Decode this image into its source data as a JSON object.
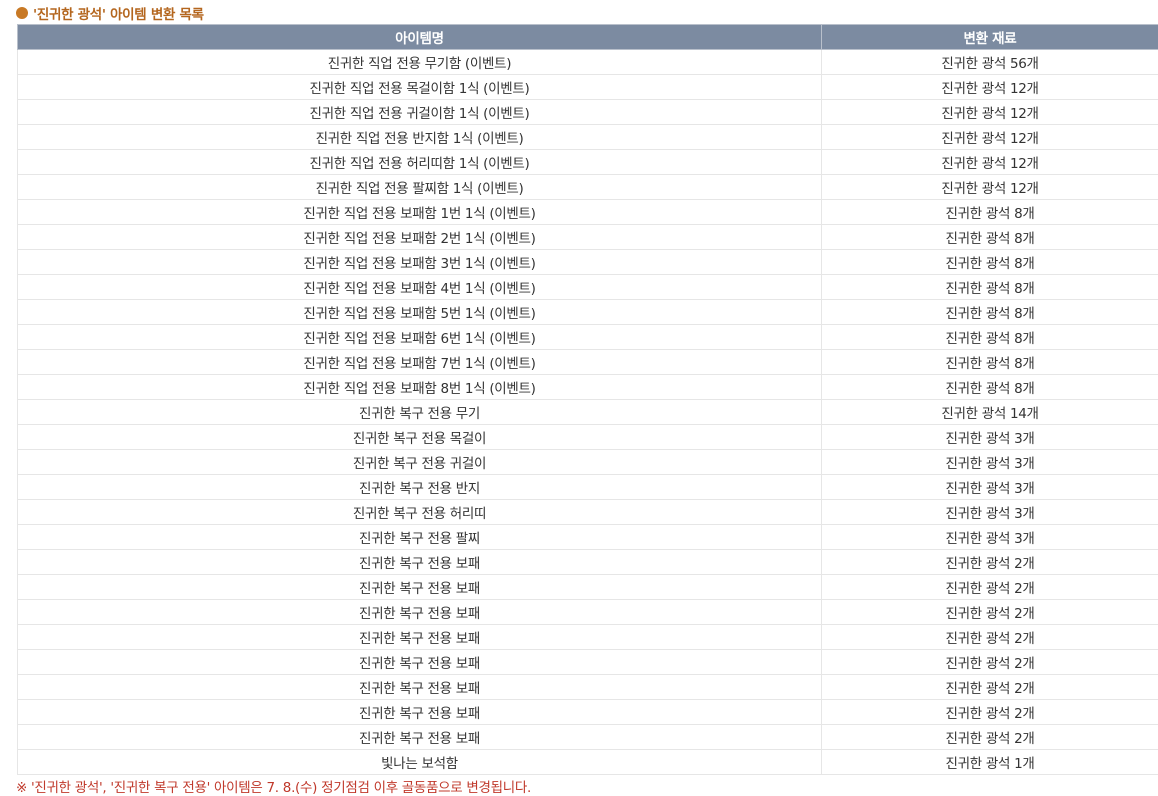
{
  "header": {
    "title": "'진귀한 광석' 아이템 변환 목록",
    "bullet_color": "#c87925",
    "title_color": "#b4661e"
  },
  "table": {
    "columns": [
      "아이템명",
      "변환 재료"
    ],
    "header_bg": "#7c8ba1",
    "rows": [
      {
        "item": "진귀한 직업 전용 무기함 (이벤트)",
        "material": "진귀한 광석 56개"
      },
      {
        "item": "진귀한 직업 전용 목걸이함 1식 (이벤트)",
        "material": "진귀한 광석 12개"
      },
      {
        "item": "진귀한 직업 전용 귀걸이함 1식 (이벤트)",
        "material": "진귀한 광석 12개"
      },
      {
        "item": "진귀한 직업 전용 반지함 1식 (이벤트)",
        "material": "진귀한 광석 12개"
      },
      {
        "item": "진귀한 직업 전용 허리띠함 1식 (이벤트)",
        "material": "진귀한 광석 12개"
      },
      {
        "item": "진귀한 직업 전용 팔찌함 1식 (이벤트)",
        "material": "진귀한 광석 12개"
      },
      {
        "item": "진귀한 직업 전용 보패함 1번 1식 (이벤트)",
        "material": "진귀한 광석 8개"
      },
      {
        "item": "진귀한 직업 전용 보패함 2번 1식 (이벤트)",
        "material": "진귀한 광석 8개"
      },
      {
        "item": "진귀한 직업 전용 보패함 3번 1식 (이벤트)",
        "material": "진귀한 광석 8개"
      },
      {
        "item": "진귀한 직업 전용 보패함 4번 1식 (이벤트)",
        "material": "진귀한 광석 8개"
      },
      {
        "item": "진귀한 직업 전용 보패함 5번 1식 (이벤트)",
        "material": "진귀한 광석 8개"
      },
      {
        "item": "진귀한 직업 전용 보패함 6번 1식 (이벤트)",
        "material": "진귀한 광석 8개"
      },
      {
        "item": "진귀한 직업 전용 보패함 7번 1식 (이벤트)",
        "material": "진귀한 광석 8개"
      },
      {
        "item": "진귀한 직업 전용 보패함 8번 1식 (이벤트)",
        "material": "진귀한 광석 8개"
      },
      {
        "item": "진귀한 복구 전용 무기",
        "material": "진귀한 광석 14개"
      },
      {
        "item": "진귀한 복구 전용 목걸이",
        "material": "진귀한 광석 3개"
      },
      {
        "item": "진귀한 복구 전용 귀걸이",
        "material": "진귀한 광석 3개"
      },
      {
        "item": "진귀한 복구 전용 반지",
        "material": "진귀한 광석 3개"
      },
      {
        "item": "진귀한 복구 전용 허리띠",
        "material": "진귀한 광석 3개"
      },
      {
        "item": "진귀한 복구 전용 팔찌",
        "material": "진귀한 광석 3개"
      },
      {
        "item": "진귀한 복구 전용 보패",
        "material": "진귀한 광석 2개"
      },
      {
        "item": "진귀한 복구 전용 보패",
        "material": "진귀한 광석 2개"
      },
      {
        "item": "진귀한 복구 전용 보패",
        "material": "진귀한 광석 2개"
      },
      {
        "item": "진귀한 복구 전용 보패",
        "material": "진귀한 광석 2개"
      },
      {
        "item": "진귀한 복구 전용 보패",
        "material": "진귀한 광석 2개"
      },
      {
        "item": "진귀한 복구 전용 보패",
        "material": "진귀한 광석 2개"
      },
      {
        "item": "진귀한 복구 전용 보패",
        "material": "진귀한 광석 2개"
      },
      {
        "item": "진귀한 복구 전용 보패",
        "material": "진귀한 광석 2개"
      },
      {
        "item": "빛나는 보석함",
        "material": "진귀한 광석 1개"
      }
    ]
  },
  "footnote": {
    "text": "※ '진귀한 광석', '진귀한 복구 전용' 아이템은 7. 8.(수) 정기점검 이후 골동품으로 변경됩니다.",
    "color": "#c0392b"
  }
}
